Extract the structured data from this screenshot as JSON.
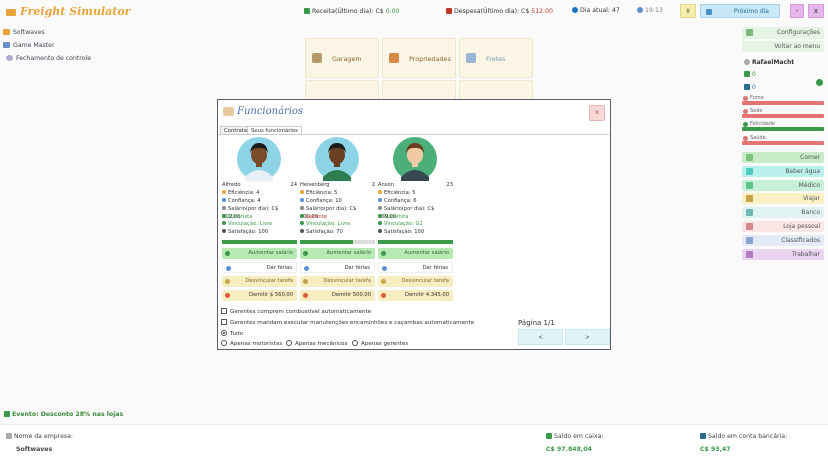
{
  "app": {
    "title": "Freight Simulator"
  },
  "topbar": {
    "income_label": "Receita(Último dia): C$",
    "income_value": "0.00",
    "expense_label": "Despesa(Último dia): C$",
    "expense_value": "512.00",
    "day_label": "Dia atual:",
    "day_value": "47",
    "clock": "19:13",
    "pause_label": "II",
    "next_day_label": "Próximo dia",
    "min_label": "-",
    "close_label": "x"
  },
  "left_menu": [
    {
      "label": "Softwaves"
    },
    {
      "label": "Game Master"
    },
    {
      "label": "Fechamento de controle"
    }
  ],
  "tiles": [
    {
      "label": "Garagem"
    },
    {
      "label": "Propriedades"
    },
    {
      "label": "Fretes"
    }
  ],
  "right_panel": {
    "settings_label": "Configurações",
    "menu_label": "Voltar ao menu",
    "player_name": "RafaelMacht",
    "money_small": "0",
    "bank_small": "0",
    "bars": [
      {
        "label": "Fome",
        "value": 1.0,
        "color": "#e57373"
      },
      {
        "label": "Sede",
        "value": 1.0,
        "color": "#e57373"
      },
      {
        "label": "Felicidade",
        "value": 1.0,
        "color": "#3a9a4a"
      },
      {
        "label": "Saúde",
        "value": 1.0,
        "color": "#e57373"
      }
    ],
    "buttons": [
      {
        "label": "Comer",
        "bg": "#c8ecc8",
        "icon": "#7cc47c"
      },
      {
        "label": "Beber água",
        "bg": "#b9f0ec",
        "icon": "#4ec9c0"
      },
      {
        "label": "Médico",
        "bg": "#c7f0d8",
        "icon": "#5dc48a"
      },
      {
        "label": "Viajar",
        "bg": "#fbefc6",
        "icon": "#c6a24a"
      },
      {
        "label": "Banco",
        "bg": "#dff3f3",
        "icon": "#6fb7b7"
      },
      {
        "label": "Loja pessoal",
        "bg": "#fbe6e6",
        "icon": "#d88a8a"
      },
      {
        "label": "Classificados",
        "bg": "#e3ebf7",
        "icon": "#8aa1d4"
      },
      {
        "label": "Trabalhar",
        "bg": "#ead4ef",
        "icon": "#b37bbf"
      }
    ]
  },
  "dialog": {
    "title": "Funcionários",
    "close_label": "x",
    "tabs": [
      "Contratar",
      "Seus funcionários"
    ],
    "employees": [
      {
        "name": "Alfredo",
        "age": "24",
        "avatar_skin": "#7a4a2a",
        "avatar_hair": "#1b1b1b",
        "avatar_bg": "#8fd3e6",
        "avatar_shirt": "#e8f0f6",
        "efficiency": "Eficiência: 4",
        "trust": "Confiança: 4",
        "salary": "Salário(por dia): C$ 512,00",
        "role": "Motorista",
        "link": "Vinculação: Livre",
        "satisfaction": "Satisfação: 100",
        "satisfaction_level": 1.0,
        "btn_raise": "Aumentar salário",
        "btn_vacation": "Dar férias",
        "btn_unlink": "Desvincular tarefa",
        "btn_fire": "Demitir $ 560,00"
      },
      {
        "name": "Heisenberg",
        "age": "2",
        "avatar_skin": "#6a3f22",
        "avatar_hair": "#1b1b1b",
        "avatar_bg": "#8fd3e6",
        "avatar_shirt": "#2e7d4f",
        "efficiency": "Eficiência: 5",
        "trust": "Confiança: 10",
        "salary": "Salário(por dia): C$ 200,00",
        "role": "Gerente",
        "link": "Vinculação: Livre",
        "satisfaction": "Satisfação: 70",
        "satisfaction_level": 0.7,
        "btn_raise": "Aumentar salário",
        "btn_vacation": "Dar férias",
        "btn_unlink": "Desvincular tarefa",
        "btn_fire": "Demitir 500,00"
      },
      {
        "name": "Anson",
        "age": "23",
        "avatar_skin": "#f1c9a5",
        "avatar_hair": "#6b3e1f",
        "avatar_bg": "#4caf7a",
        "avatar_shirt": "#37474f",
        "efficiency": "Eficiência: 5",
        "trust": "Confiança: 6",
        "salary": "Salário(por dia): C$ 869,00",
        "role": "Motorista",
        "link": "Vinculação: G1",
        "satisfaction": "Satisfação: 100",
        "satisfaction_level": 1.0,
        "btn_raise": "Aumentar salário",
        "btn_vacation": "Dar férias",
        "btn_unlink": "Desvincular tarefa",
        "btn_fire": "Demitir 4.345,00"
      }
    ],
    "opt_fuel": "Gerentes comprem combustível automaticamente",
    "opt_maint": "Gerentes mandam executar manutenções encaminhões e caçambas automaticamente",
    "filter_all": "Tudo",
    "filter_drivers": "Apenas motoristas",
    "filter_mechanics": "Apenas mecânicos",
    "filter_managers": "Apenas gerentes",
    "page_label": "Página 1/1",
    "prev_label": "<",
    "next_label": ">"
  },
  "footer": {
    "event_text": "Evento: Desconto 28% nas lojas",
    "company_label": "Nome da empresa:",
    "company_value": "Softwaves",
    "cash_label": "Saldo em caixa:",
    "cash_value": "C$ 97.848,04",
    "bank_label": "Saldo em conta bancária:",
    "bank_value": "C$ 93,47"
  }
}
